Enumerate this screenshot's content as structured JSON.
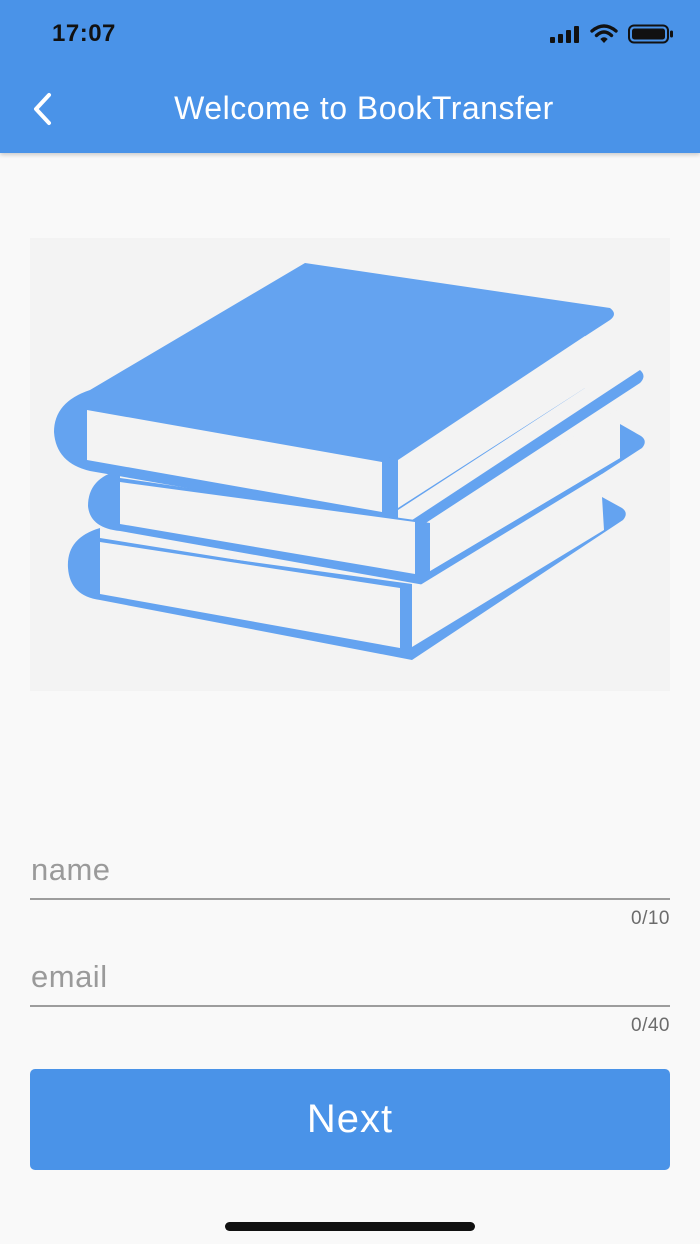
{
  "status_bar": {
    "time": "17:07",
    "icons": [
      "signal-icon",
      "wifi-icon",
      "battery-icon"
    ]
  },
  "header": {
    "title": "Welcome to BookTransfer",
    "back_icon": "chevron-left-icon"
  },
  "hero": {
    "icon": "books-stack-icon"
  },
  "form": {
    "name": {
      "value": "",
      "placeholder": "name",
      "counter": "0/10"
    },
    "email": {
      "value": "",
      "placeholder": "email",
      "counter": "0/40"
    }
  },
  "actions": {
    "next_label": "Next"
  },
  "colors": {
    "primary": "#4a93e8",
    "illustration": "#64a3f0",
    "background": "#f9f9f9"
  }
}
